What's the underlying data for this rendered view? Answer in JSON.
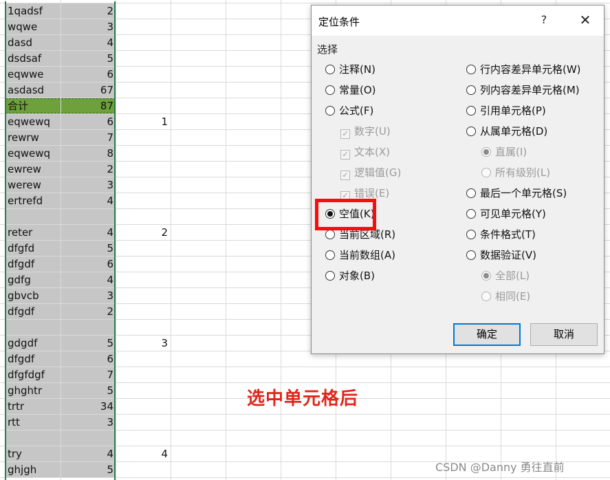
{
  "sheet": {
    "rows": [
      {
        "a": "1qadsf",
        "b": "2",
        "d": ""
      },
      {
        "a": "wqwe",
        "b": "3",
        "d": ""
      },
      {
        "a": "dasd",
        "b": "4",
        "d": ""
      },
      {
        "a": "dsdsaf",
        "b": "5",
        "d": ""
      },
      {
        "a": "eqwwe",
        "b": "6",
        "d": ""
      },
      {
        "a": "asdasd",
        "b": "67",
        "d": ""
      },
      {
        "a": "合计",
        "b": "87",
        "d": "",
        "total": true
      },
      {
        "a": "eqwewq",
        "b": "6",
        "d": "1"
      },
      {
        "a": "rewrw",
        "b": "7",
        "d": ""
      },
      {
        "a": "eqwewq",
        "b": "8",
        "d": ""
      },
      {
        "a": "ewrew",
        "b": "2",
        "d": ""
      },
      {
        "a": "werew",
        "b": "3",
        "d": ""
      },
      {
        "a": "ertrefd",
        "b": "4",
        "d": ""
      },
      {
        "a": "",
        "b": "",
        "d": ""
      },
      {
        "a": "reter",
        "b": "4",
        "d": "2"
      },
      {
        "a": "dfgfd",
        "b": "5",
        "d": ""
      },
      {
        "a": "dfgdf",
        "b": "6",
        "d": ""
      },
      {
        "a": "gdfg",
        "b": "4",
        "d": ""
      },
      {
        "a": "gbvcb",
        "b": "3",
        "d": ""
      },
      {
        "a": "dfgdf",
        "b": "2",
        "d": ""
      },
      {
        "a": "",
        "b": "",
        "d": ""
      },
      {
        "a": "gdgdf",
        "b": "5",
        "d": "3"
      },
      {
        "a": "dfgdf",
        "b": "6",
        "d": ""
      },
      {
        "a": "dfgfdgf",
        "b": "7",
        "d": ""
      },
      {
        "a": "ghghtr",
        "b": "5",
        "d": ""
      },
      {
        "a": "trtr",
        "b": "34",
        "d": ""
      },
      {
        "a": "rtt",
        "b": "3",
        "d": ""
      },
      {
        "a": "",
        "b": "",
        "d": ""
      },
      {
        "a": "try",
        "b": "4",
        "d": "4"
      },
      {
        "a": "ghjgh",
        "b": "5",
        "d": ""
      }
    ]
  },
  "annotation": "选中单元格后",
  "watermark": "CSDN @Danny 勇往直前",
  "dialog": {
    "title": "定位条件",
    "help": "?",
    "close": "✕",
    "section_label": "选择",
    "left_options": [
      {
        "label": "注释(N)",
        "kind": "radio",
        "selected": false,
        "disabled": false,
        "indent": false
      },
      {
        "label": "常量(O)",
        "kind": "radio",
        "selected": false,
        "disabled": false,
        "indent": false
      },
      {
        "label": "公式(F)",
        "kind": "radio",
        "selected": false,
        "disabled": false,
        "indent": false
      },
      {
        "label": "数字(U)",
        "kind": "check",
        "selected": true,
        "disabled": true,
        "indent": true
      },
      {
        "label": "文本(X)",
        "kind": "check",
        "selected": true,
        "disabled": true,
        "indent": true
      },
      {
        "label": "逻辑值(G)",
        "kind": "check",
        "selected": true,
        "disabled": true,
        "indent": true
      },
      {
        "label": "错误(E)",
        "kind": "check",
        "selected": true,
        "disabled": true,
        "indent": true
      },
      {
        "label": "空值(K)",
        "kind": "radio",
        "selected": true,
        "disabled": false,
        "indent": false
      },
      {
        "label": "当前区域(R)",
        "kind": "radio",
        "selected": false,
        "disabled": false,
        "indent": false
      },
      {
        "label": "当前数组(A)",
        "kind": "radio",
        "selected": false,
        "disabled": false,
        "indent": false
      },
      {
        "label": "对象(B)",
        "kind": "radio",
        "selected": false,
        "disabled": false,
        "indent": false
      }
    ],
    "right_options": [
      {
        "label": "行内容差异单元格(W)",
        "kind": "radio",
        "selected": false,
        "disabled": false,
        "indent": false
      },
      {
        "label": "列内容差异单元格(M)",
        "kind": "radio",
        "selected": false,
        "disabled": false,
        "indent": false
      },
      {
        "label": "引用单元格(P)",
        "kind": "radio",
        "selected": false,
        "disabled": false,
        "indent": false
      },
      {
        "label": "从属单元格(D)",
        "kind": "radio",
        "selected": false,
        "disabled": false,
        "indent": false
      },
      {
        "label": "直属(I)",
        "kind": "radio",
        "selected": true,
        "disabled": true,
        "indent": true
      },
      {
        "label": "所有级别(L)",
        "kind": "radio",
        "selected": false,
        "disabled": true,
        "indent": true
      },
      {
        "label": "最后一个单元格(S)",
        "kind": "radio",
        "selected": false,
        "disabled": false,
        "indent": false
      },
      {
        "label": "可见单元格(Y)",
        "kind": "radio",
        "selected": false,
        "disabled": false,
        "indent": false
      },
      {
        "label": "条件格式(T)",
        "kind": "radio",
        "selected": false,
        "disabled": false,
        "indent": false
      },
      {
        "label": "数据验证(V)",
        "kind": "radio",
        "selected": false,
        "disabled": false,
        "indent": false
      },
      {
        "label": "全部(L)",
        "kind": "radio",
        "selected": true,
        "disabled": true,
        "indent": true
      },
      {
        "label": "相同(E)",
        "kind": "radio",
        "selected": false,
        "disabled": true,
        "indent": true
      }
    ],
    "ok_label": "确定",
    "cancel_label": "取消"
  }
}
